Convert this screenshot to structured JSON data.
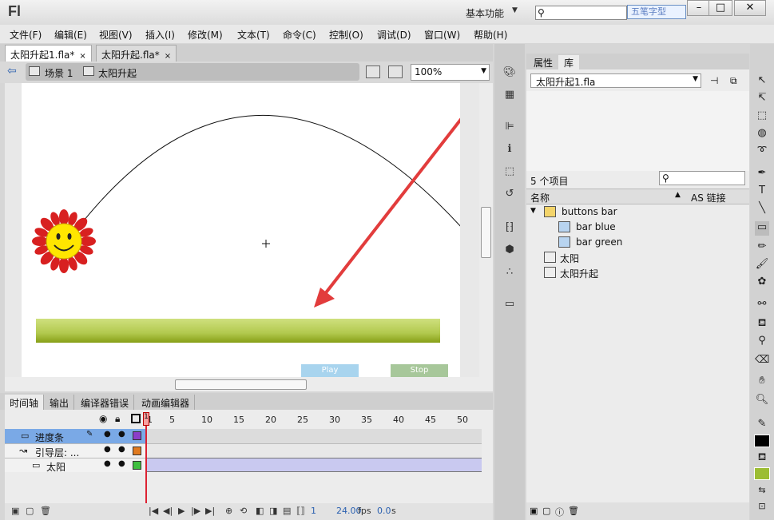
{
  "app": {
    "logo": "Fl",
    "workspace": "基本功能",
    "search_placeholder": "",
    "ime_badge": "五笔字型"
  },
  "menu": [
    "文件(F)",
    "编辑(E)",
    "视图(V)",
    "插入(I)",
    "修改(M)",
    "文本(T)",
    "命令(C)",
    "控制(O)",
    "调试(D)",
    "窗口(W)",
    "帮助(H)"
  ],
  "doc_tabs": [
    {
      "label": "太阳升起1.fla*",
      "close": "×"
    },
    {
      "label": "太阳升起.fla*",
      "close": "×"
    }
  ],
  "editbar": {
    "scene": "场景 1",
    "symbol": "太阳升起",
    "zoom": "100%"
  },
  "stage": {
    "buttons": [
      {
        "label": "Play",
        "color": "#a8d4ee"
      },
      {
        "label": "Stop",
        "color": "#a7c79a"
      }
    ],
    "ground_colors": [
      "#c9dc7a",
      "#8eaa1d"
    ],
    "arrow_color": "#e23c3c"
  },
  "timeline": {
    "tabs": [
      "时间轴",
      "输出",
      "编译器错误",
      "动画编辑器"
    ],
    "frame_numbers": [
      "1",
      "5",
      "10",
      "15",
      "20",
      "25",
      "30",
      "35",
      "40",
      "45",
      "50"
    ],
    "current_frame_marker": "1",
    "layers": [
      {
        "name": "进度条",
        "color": "#8b3ec9",
        "selected": true
      },
      {
        "name": "引导层: ...",
        "color": "#e07a1f",
        "selected": false
      },
      {
        "name": "太阳",
        "color": "#3fbf3f",
        "selected": false
      }
    ],
    "status": {
      "frame": "1",
      "fps": "24.00",
      "fps_unit": "fps",
      "time": "0.0",
      "time_unit": "s"
    }
  },
  "library": {
    "tabs": [
      "属性",
      "库"
    ],
    "active_tab": "库",
    "file": "太阳升起1.fla",
    "item_count": "5 个项目",
    "col_name": "名称",
    "col_linkage": "AS 链接",
    "items": [
      {
        "label": "buttons bar",
        "type": "folder",
        "indent": 0
      },
      {
        "label": "bar blue",
        "type": "button",
        "indent": 1
      },
      {
        "label": "bar green",
        "type": "button",
        "indent": 1
      },
      {
        "label": "太阳",
        "type": "graphic",
        "indent": 0
      },
      {
        "label": "太阳升起",
        "type": "movieclip",
        "indent": 0
      }
    ]
  }
}
